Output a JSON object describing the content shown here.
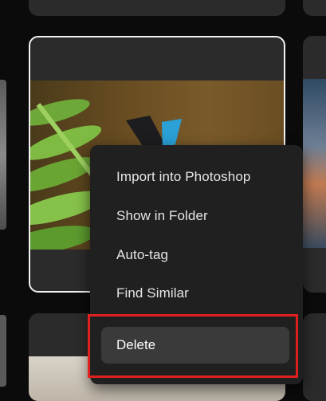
{
  "context_menu": {
    "items": [
      {
        "label": "Import into Photoshop"
      },
      {
        "label": "Show in Folder"
      },
      {
        "label": "Auto-tag"
      },
      {
        "label": "Find Similar"
      },
      {
        "label": "Delete"
      }
    ],
    "highlighted": "Delete"
  },
  "annotation": {
    "color": "#e0201f",
    "target": "Delete"
  },
  "colors": {
    "selection_border": "#f2f2f2",
    "menu_bg": "#202020",
    "highlight_bg": "#3a3a3a"
  }
}
